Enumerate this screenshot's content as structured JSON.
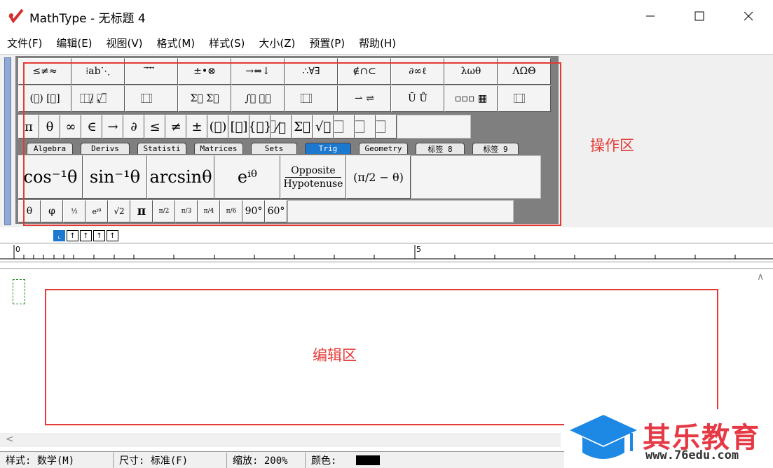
{
  "window": {
    "title": "MathType - 无标题 4"
  },
  "menu": [
    "文件(F)",
    "编辑(E)",
    "视图(V)",
    "格式(M)",
    "样式(S)",
    "大小(Z)",
    "预置(P)",
    "帮助(H)"
  ],
  "palette": {
    "row1": [
      "≤≠≈",
      "⁞ab⋱",
      "⃗ ⃗ ⃗",
      "±•⊗",
      "→⇔↓",
      "∴∀∃",
      "∉∩⊂",
      "∂∞ℓ",
      "λωθ",
      "ΛΩΘ"
    ],
    "row2": [
      "(⃞) [⃞]",
      "⃞/⃞ √⃞",
      "⃞ ⃞",
      "Σ⃞ Σ⃞",
      "∫⃞ ∮⃞",
      "⃞ ⃞",
      "⇀ ⇌",
      "Ū Ů",
      "▫▫▫ ▦",
      "⃞ ⃞"
    ],
    "row3": [
      "π",
      "θ",
      "∞",
      "∈",
      "→",
      "∂",
      "≤",
      "≠",
      "±",
      "(⃞)",
      "[⃞]",
      "{⃞}",
      "⃞⁄⃞",
      "Σ⃞",
      "√⃞",
      "⃞",
      "⃞",
      "⃞"
    ],
    "tabs": [
      "Algebra",
      "Derivs",
      "Statisti",
      "Matrices",
      "Sets",
      "Trig",
      "Geometry",
      "标签 8",
      "标签 9"
    ],
    "active_tab": "Trig",
    "row5": [
      "cos⁻¹θ",
      "sin⁻¹θ",
      "arcsinθ",
      "eⁱᶿ"
    ],
    "opposite": "Opposite",
    "hypotenuse": "Hypotenuse",
    "pi_minus": "(π/2 − θ)",
    "row6": [
      "θ",
      "φ",
      "½",
      "eⁱᶿ",
      "√2",
      "π",
      "π/2",
      "π/3",
      "π/4",
      "π/6",
      "90°",
      "60°"
    ]
  },
  "annotations": {
    "ops_label": "操作区",
    "edit_label": "编辑区"
  },
  "align_buttons": [
    "⌞",
    "↑",
    "↑",
    "↑",
    "↑"
  ],
  "ruler": {
    "mark0": "0",
    "mark5": "5"
  },
  "status": {
    "style": "样式: 数学(M)",
    "size": "尺寸: 标准(F)",
    "zoom": "缩放: 200%",
    "color_label": "颜色:"
  },
  "watermark": {
    "title": "其乐教育",
    "url": "www.76edu.com"
  },
  "colors": {
    "accent": "#1d78d0",
    "annotation": "#e53935",
    "brand": "#e53945"
  }
}
